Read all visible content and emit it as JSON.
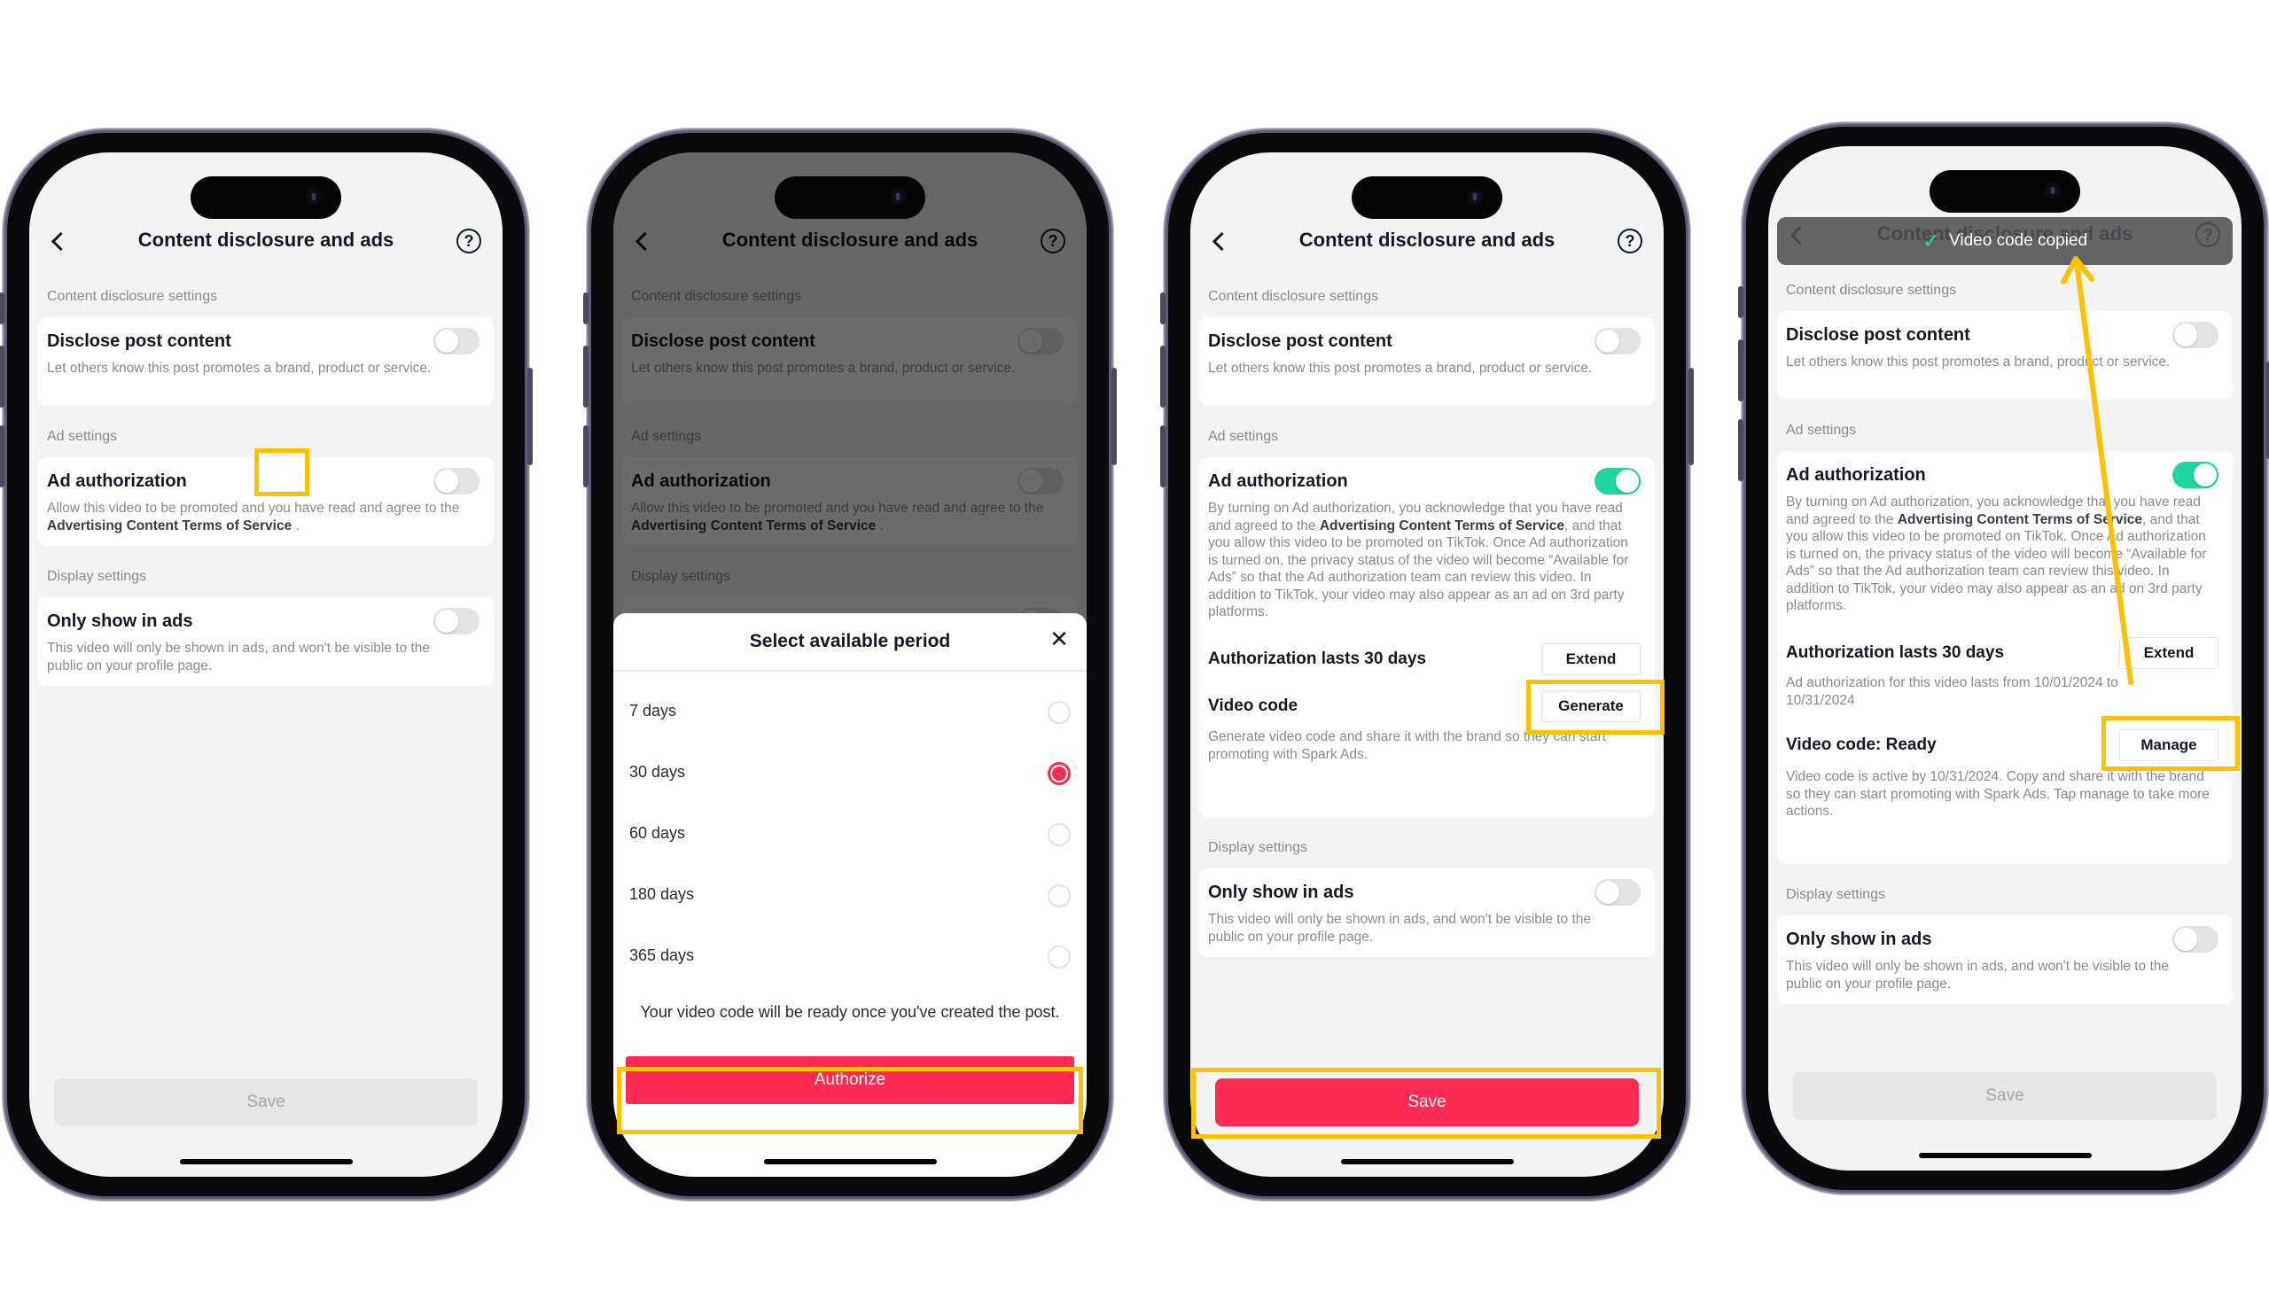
{
  "colors": {
    "accent": "#fe2c55",
    "toggle_on": "#20d5a0",
    "highlight": "#fcc200"
  },
  "header": {
    "title": "Content disclosure and ads",
    "back_icon": "chevron-left-icon",
    "help_icon": "question-circle-icon",
    "help_glyph": "?"
  },
  "sections": {
    "content_disclosure": "Content disclosure settings",
    "ad": "Ad settings",
    "display": "Display settings"
  },
  "items": {
    "disclose": {
      "title": "Disclose post content",
      "desc": "Let others know this post promotes a brand, product or service."
    },
    "ad_auth": {
      "title": "Ad authorization",
      "desc_off_prefix": "Allow this video to be promoted and you have read and agree to the ",
      "terms_link": "Advertising Content Terms of Service",
      "desc_off_suffix": " .",
      "terms_link_on": "Advertising Content Terms of Service",
      "desc_on_prefix": "By turning on Ad authorization, you acknowledge that you have read and agreed to the ",
      "desc_on_suffix": ", and that you allow this video to be promoted on TikTok. Once Ad authorization is turned on, the privacy status of the video will become “Available for Ads” so that the Ad authorization team can review this video. In addition to TikTok, your video may also appear as an ad on 3rd party platforms."
    },
    "authorization_lasts": {
      "title": "Authorization lasts 30 days",
      "button": "Extend",
      "desc": "Ad authorization for this video lasts from 10/01/2024 to 10/31/2024"
    },
    "video_code": {
      "title": "Video code",
      "button": "Generate",
      "desc": "Generate video code and share it with the brand so they can start promoting with Spark Ads."
    },
    "video_code_ready": {
      "title": "Video code: Ready",
      "button": "Manage",
      "desc": "Video code is active by 10/31/2024. Copy and share it with the brand so they can start promoting with Spark Ads. Tap manage to take more actions."
    },
    "only_ads": {
      "title": "Only show in ads",
      "desc": "This video will only be shown in ads, and won't be visible to the public on your profile page."
    }
  },
  "screens": [
    {
      "id": "step-1",
      "toggles": {
        "disclose": false,
        "ad_auth": false,
        "only_ads": false
      },
      "save_label": "Save",
      "save_enabled": false
    },
    {
      "id": "step-2",
      "toggles": {
        "disclose": false,
        "ad_auth": false,
        "only_ads": false
      },
      "sheet": {
        "title": "Select available period",
        "close_glyph": "✕",
        "options": [
          {
            "label": "7 days",
            "selected": false
          },
          {
            "label": "30 days",
            "selected": true
          },
          {
            "label": "60 days",
            "selected": false
          },
          {
            "label": "180 days",
            "selected": false
          },
          {
            "label": "365 days",
            "selected": false
          }
        ],
        "note": "Your video code will be ready once you've created the post.",
        "authorize_label": "Authorize"
      }
    },
    {
      "id": "step-3",
      "toggles": {
        "disclose": false,
        "ad_auth": true,
        "only_ads": false
      },
      "save_label": "Save",
      "save_enabled": true
    },
    {
      "id": "step-4",
      "toggles": {
        "disclose": false,
        "ad_auth": true,
        "only_ads": false
      },
      "toast": {
        "icon": "check-icon",
        "glyph": "✓",
        "text": "Video code copied"
      },
      "save_label": "Save",
      "save_enabled": false
    }
  ]
}
